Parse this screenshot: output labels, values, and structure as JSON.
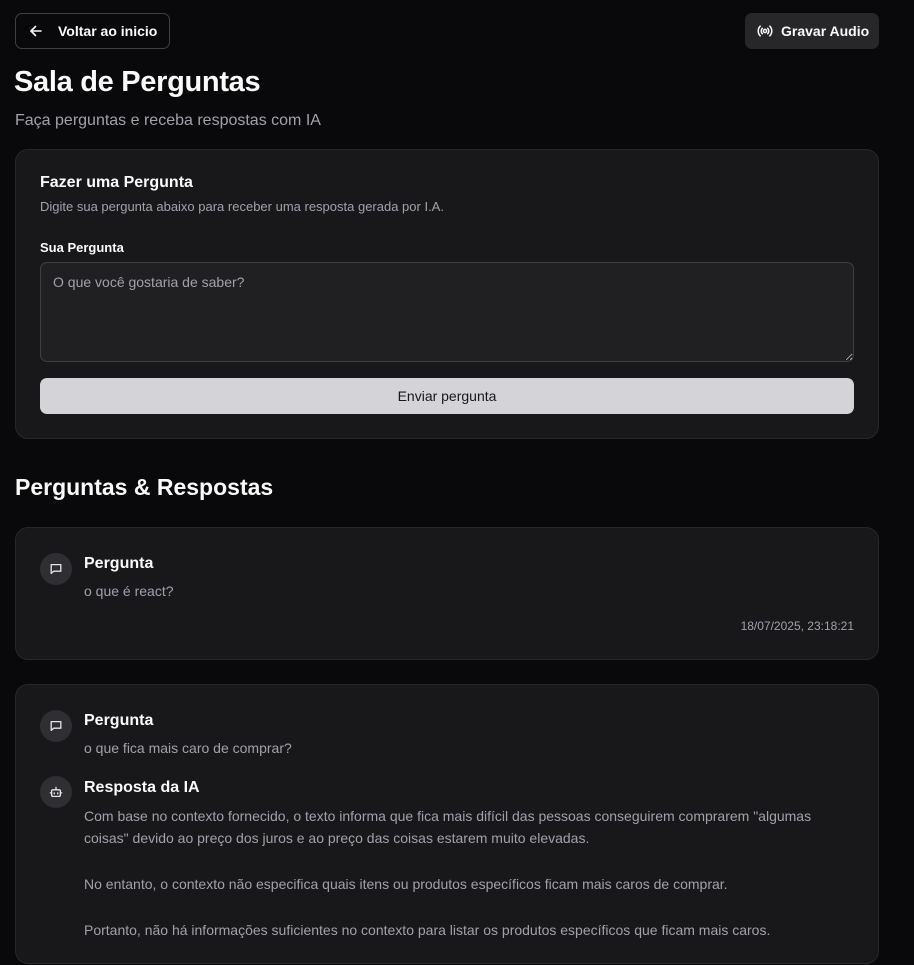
{
  "header": {
    "back_label": "Voltar ao inicio",
    "audio_label": "Gravar Audio",
    "back_icon": "arrow-left-icon",
    "audio_icon": "radio-icon"
  },
  "page": {
    "title": "Sala de Perguntas",
    "subtitle": "Faça perguntas e receba respostas com IA"
  },
  "ask_form": {
    "title": "Fazer uma Pergunta",
    "description": "Digite sua pergunta abaixo para receber uma resposta gerada por I.A.",
    "field_label": "Sua Pergunta",
    "placeholder": "O que você gostaria de saber?",
    "value": "",
    "submit_label": "Enviar pergunta"
  },
  "qa_section": {
    "title": "Perguntas & Respostas",
    "items": [
      {
        "question_heading": "Pergunta",
        "question": "o que é react?",
        "timestamp": "18/07/2025, 23:18:21"
      },
      {
        "question_heading": "Pergunta",
        "question": "o que fica mais caro de comprar?",
        "answer_heading": "Resposta da IA",
        "answer_paragraphs": [
          "Com base no contexto fornecido, o texto informa que fica mais difícil das pessoas conseguirem comprarem \"algumas coisas\" devido ao preço dos juros e ao preço das coisas estarem muito elevadas.",
          "No entanto, o contexto não especifica quais itens ou produtos específicos ficam mais caros de comprar.",
          "Portanto, não há informações suficientes no contexto para listar os produtos específicos que ficam mais caros."
        ]
      }
    ]
  },
  "colors": {
    "background": "#09090b",
    "card": "#18181b",
    "border": "#27272a",
    "muted_text": "#a1a1aa",
    "primary_button": "#d4d4d8"
  }
}
